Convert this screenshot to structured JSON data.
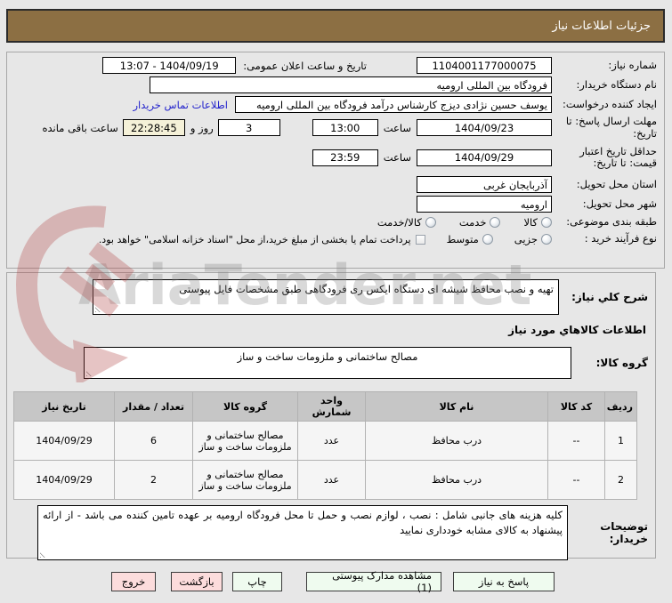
{
  "header": {
    "title": "جزئیات اطلاعات نیاز"
  },
  "info": {
    "need_number": {
      "label": "شماره نیاز:",
      "value": "1104001177000075"
    },
    "announce": {
      "label": "تاریخ و ساعت اعلان عمومی:",
      "value": "1404/09/19 - 13:07"
    },
    "buyer_org": {
      "label": "نام دستگاه خریدار:",
      "value": "فرودگاه بین المللی ارومیه"
    },
    "creator": {
      "label": "ایجاد کننده درخواست:",
      "value": "یوسف حسین نژادی دیزج کارشناس درآمد فرودگاه بین المللی ارومیه",
      "link": "اطلاعات تماس خریدار"
    },
    "deadline": {
      "label": "مهلت ارسال پاسخ: تا تاریخ:",
      "date": "1404/09/23",
      "hour_label": "ساعت",
      "time": "13:00",
      "days": "3",
      "days_label": "روز و",
      "countdown": "22:28:45",
      "countdown_label": "ساعت باقی مانده"
    },
    "validity": {
      "label": "حداقل تاریخ اعتبار قیمت: تا تاریخ:",
      "date": "1404/09/29",
      "hour_label": "ساعت",
      "time": "23:59"
    },
    "province": {
      "label": "استان محل تحویل:",
      "value": "آذربایجان غربی"
    },
    "city": {
      "label": "شهر محل تحویل:",
      "value": "ارومیه"
    },
    "category": {
      "label": "طبقه بندی موضوعی:",
      "options": [
        "کالا",
        "خدمت",
        "کالا/خدمت"
      ]
    },
    "process": {
      "label": "نوع فرآیند خرید :",
      "options": [
        "جزیی",
        "متوسط"
      ],
      "checkbox_label": "پرداخت تمام یا بخشی از مبلغ خرید،از محل \"اسناد خزانه اسلامی\" خواهد بود."
    }
  },
  "need_desc": {
    "label": "شرح کلي نیاز:",
    "value": "تهیه و نصب محافظ شیشه ای دستگاه ایکس ری فرودگاهی طبق مشخصات فایل پیوستی"
  },
  "goods": {
    "title": "اطلاعات کالاهاي مورد نیاز",
    "group_label": "گروه کالا:",
    "group_value": "مصالح ساختمانی و ملزومات ساخت و ساز",
    "table": {
      "headers": [
        "ردیف",
        "کد کالا",
        "نام کالا",
        "واحد شمارش",
        "گروه کالا",
        "تعداد / مقدار",
        "تاریخ نیاز"
      ],
      "rows": [
        [
          "1",
          "--",
          "درب محافظ",
          "عدد",
          "مصالح ساختمانی و ملزومات ساخت و ساز",
          "6",
          "1404/09/29"
        ],
        [
          "2",
          "--",
          "درب محافظ",
          "عدد",
          "مصالح ساختمانی و ملزومات ساخت و ساز",
          "2",
          "1404/09/29"
        ]
      ]
    },
    "notes_label": "توضیحات خریدار:",
    "notes_value": "کلیه هزینه های جانبی شامل : نصب ، لوازم نصب و حمل تا محل فرودگاه ارومیه بر عهده تامین کننده می باشد - از ارائه پیشنهاد به کالای مشابه خودداری نمایید"
  },
  "buttons": {
    "reply": "پاسخ به نیاز",
    "docs": "مشاهده مدارک پیوستی (1)",
    "print": "چاپ",
    "back": "بازگشت",
    "exit": "خروج"
  },
  "watermark": {
    "text": "AriaTender.net"
  },
  "colors": {
    "titlebar": "#8c6f43",
    "link": "#2323cc",
    "countdown_bg": "#f5f1d8",
    "button_green_bg": "#effbef",
    "button_pink_bg": "#fcdcdc",
    "table_header_bg": "#c6c6c6",
    "watermark_red": "#b04040"
  }
}
